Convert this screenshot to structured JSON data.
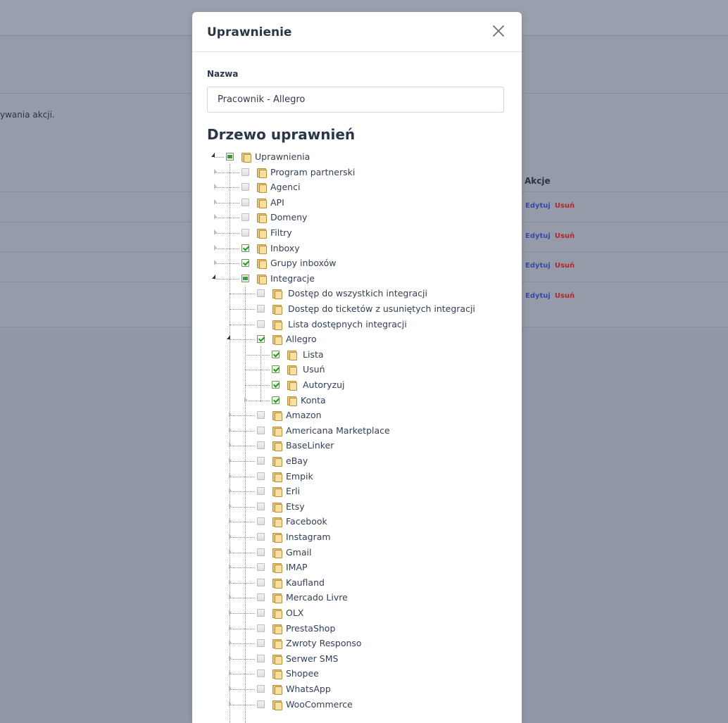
{
  "background": {
    "description_fragment": "ywania akcji.",
    "table_header_actions": "Akcje",
    "rows": [
      {
        "edit": "Edytuj",
        "delete": "Usuń"
      },
      {
        "edit": "Edytuj",
        "delete": "Usuń"
      },
      {
        "edit": "Edytuj",
        "delete": "Usuń"
      },
      {
        "edit": "Edytuj",
        "delete": "Usuń"
      }
    ]
  },
  "modal": {
    "title": "Uprawnienie",
    "name_label": "Nazwa",
    "name_value": "Pracownik - Allegro",
    "tree_title": "Drzewo uprawnień",
    "tree": [
      {
        "label": "Uprawnienia",
        "state": "partial",
        "level": 0,
        "expanded": true
      },
      {
        "label": "Program partnerski",
        "state": "unchecked",
        "level": 1
      },
      {
        "label": "Agenci",
        "state": "unchecked",
        "level": 1
      },
      {
        "label": "API",
        "state": "unchecked",
        "level": 1
      },
      {
        "label": "Domeny",
        "state": "unchecked",
        "level": 1
      },
      {
        "label": "Filtry",
        "state": "unchecked",
        "level": 1
      },
      {
        "label": "Inboxy",
        "state": "checked",
        "level": 1
      },
      {
        "label": "Grupy inboxów",
        "state": "checked",
        "level": 1
      },
      {
        "label": "Integracje",
        "state": "partial",
        "level": 1,
        "expanded": true
      },
      {
        "label": "Dostęp do wszystkich integracji",
        "state": "unchecked",
        "level": 2,
        "leaf": true
      },
      {
        "label": "Dostęp do ticketów z usuniętych integracji",
        "state": "unchecked",
        "level": 2,
        "leaf": true
      },
      {
        "label": "Lista dostępnych integracji",
        "state": "unchecked",
        "level": 2,
        "leaf": true
      },
      {
        "label": "Allegro",
        "state": "checked",
        "level": 2,
        "expanded": true
      },
      {
        "label": "Lista",
        "state": "checked",
        "level": 3,
        "leaf": true
      },
      {
        "label": "Usuń",
        "state": "checked",
        "level": 3,
        "leaf": true
      },
      {
        "label": "Autoryzuj",
        "state": "checked",
        "level": 3,
        "leaf": true
      },
      {
        "label": "Konta",
        "state": "checked",
        "level": 3
      },
      {
        "label": "Amazon",
        "state": "unchecked",
        "level": 2
      },
      {
        "label": "Americana Marketplace",
        "state": "unchecked",
        "level": 2
      },
      {
        "label": "BaseLinker",
        "state": "unchecked",
        "level": 2
      },
      {
        "label": "eBay",
        "state": "unchecked",
        "level": 2
      },
      {
        "label": "Empik",
        "state": "unchecked",
        "level": 2
      },
      {
        "label": "Erli",
        "state": "unchecked",
        "level": 2
      },
      {
        "label": "Etsy",
        "state": "unchecked",
        "level": 2
      },
      {
        "label": "Facebook",
        "state": "unchecked",
        "level": 2
      },
      {
        "label": "Instagram",
        "state": "unchecked",
        "level": 2
      },
      {
        "label": "Gmail",
        "state": "unchecked",
        "level": 2
      },
      {
        "label": "IMAP",
        "state": "unchecked",
        "level": 2
      },
      {
        "label": "Kaufland",
        "state": "unchecked",
        "level": 2
      },
      {
        "label": "Mercado Livre",
        "state": "unchecked",
        "level": 2
      },
      {
        "label": "OLX",
        "state": "unchecked",
        "level": 2
      },
      {
        "label": "PrestaShop",
        "state": "unchecked",
        "level": 2
      },
      {
        "label": "Zwroty Responso",
        "state": "unchecked",
        "level": 2
      },
      {
        "label": "Serwer SMS",
        "state": "unchecked",
        "level": 2
      },
      {
        "label": "Shopee",
        "state": "unchecked",
        "level": 2
      },
      {
        "label": "WhatsApp",
        "state": "unchecked",
        "level": 2
      },
      {
        "label": "WooCommerce",
        "state": "unchecked",
        "level": 2
      }
    ]
  },
  "icons": {
    "close": "close-icon",
    "folder": "folder-icon",
    "checkbox": "checkbox-icon",
    "toggle": "tree-toggle-icon"
  },
  "colors": {
    "check_green": "#1f9a1f",
    "edit_link": "#3a4aa5",
    "delete_link": "#b3262b"
  }
}
